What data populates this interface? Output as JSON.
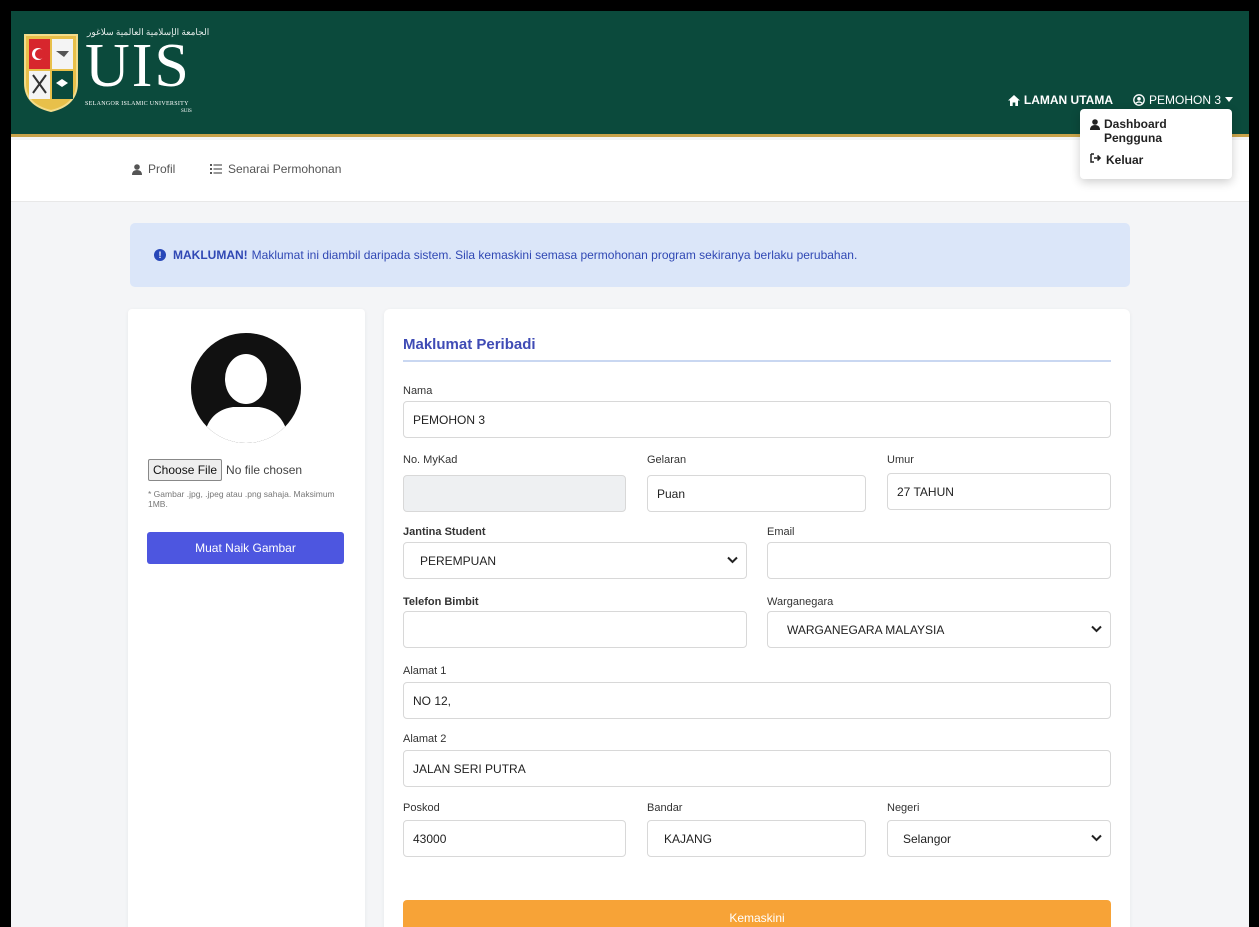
{
  "header": {
    "logo_text": "UIS",
    "logo_arabic": "الجامعة الإسلامية العالمية سلاغور",
    "logo_subtitle": "SELANGOR ISLAMIC UNIVERSITY",
    "logo_subtitle2": "SUIS",
    "nav": [
      {
        "label": "LAMAN UTAMA",
        "icon": "home-icon"
      },
      {
        "label": "PEMOHON 3",
        "icon": "user-circle-icon"
      }
    ],
    "dropdown": [
      {
        "label": "Dashboard Pengguna",
        "icon": "user-icon"
      },
      {
        "label": "Keluar",
        "icon": "sign-out-icon"
      }
    ]
  },
  "subnav": [
    {
      "label": "Profil",
      "icon": "user-icon"
    },
    {
      "label": "Senarai Permohonan",
      "icon": "list-icon"
    }
  ],
  "alert": {
    "strong": "MAKLUMAN!",
    "text": "Maklumat ini diambil daripada sistem. Sila kemaskini semasa permohonan program sekiranya berlaku perubahan."
  },
  "profile_photo": {
    "file_button": "Choose File",
    "file_status": "No file chosen",
    "hint": "* Gambar .jpg, .jpeg atau .png sahaja. Maksimum 1MB.",
    "upload_button": "Muat Naik Gambar"
  },
  "form": {
    "title": "Maklumat Peribadi",
    "nama": {
      "label": "Nama",
      "value": "PEMOHON 3"
    },
    "mykad": {
      "label": "No. MyKad",
      "value": ""
    },
    "gelaran": {
      "label": "Gelaran",
      "value": "Puan"
    },
    "umur": {
      "label": "Umur",
      "value": "27 TAHUN"
    },
    "jantina": {
      "label": "Jantina Student",
      "value": "PEREMPUAN"
    },
    "email": {
      "label": "Email",
      "value": ""
    },
    "telefon": {
      "label": "Telefon Bimbit",
      "value": ""
    },
    "warganegara": {
      "label": "Warganegara",
      "value": "WARGANEGARA MALAYSIA"
    },
    "alamat1": {
      "label": "Alamat 1",
      "value": "NO 12,"
    },
    "alamat2": {
      "label": "Alamat 2",
      "value": "JALAN SERI PUTRA"
    },
    "poskod": {
      "label": "Poskod",
      "value": "43000"
    },
    "bandar": {
      "label": "Bandar",
      "value": "KAJANG"
    },
    "negeri": {
      "label": "Negeri",
      "value": "Selangor"
    },
    "submit": "Kemaskini"
  },
  "colors": {
    "header_bg": "#0b4a3c",
    "header_accent": "#c8a24a",
    "alert_bg": "#dbe6f9",
    "primary_button": "#4d56e0",
    "submit_button": "#f7a337",
    "section_title": "#3f4bb5"
  }
}
